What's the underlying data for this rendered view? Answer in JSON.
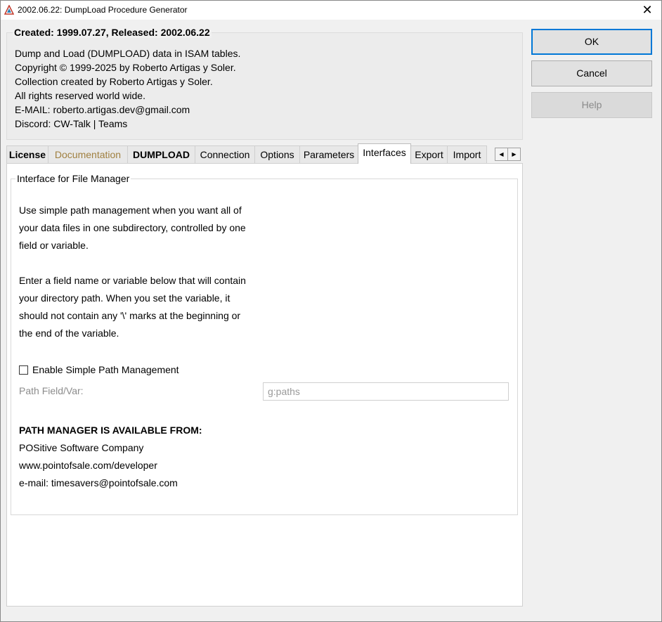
{
  "window": {
    "title": "2002.06.22: DumpLoad Procedure Generator",
    "close_glyph": "✕"
  },
  "info": {
    "caption": "Created: 1999.07.27, Released: 2002.06.22",
    "lines": [
      "Dump and Load (DUMPLOAD) data in ISAM tables.",
      "Copyright © 1999-2025 by Roberto Artigas y Soler.",
      "Collection created by Roberto Artigas y Soler.",
      "All rights reserved world wide.",
      "E-MAIL: roberto.artigas.dev@gmail.com",
      "Discord: CW-Talk | Teams"
    ]
  },
  "buttons": {
    "ok": "OK",
    "cancel": "Cancel",
    "help": "Help"
  },
  "tabs": [
    "License",
    "Documentation",
    "DUMPLOAD",
    "Connection",
    "Options",
    "Parameters",
    "Interfaces",
    "Export",
    "Import"
  ],
  "tab_scroll": {
    "left": "◀",
    "right": "▶"
  },
  "interfaces": {
    "group_caption": "Interface for File Manager",
    "para1": [
      "Use simple path management when you want all of",
      "your data files in one subdirectory, controlled by one",
      "field or variable."
    ],
    "para2": [
      "Enter a field name or variable below that will contain",
      "your directory path. When you set the variable, it",
      "should not contain any '\\' marks at the beginning or",
      "the end of the variable."
    ],
    "checkbox_label": "Enable Simple Path Management",
    "path_label": "Path Field/Var:",
    "path_value": "g:paths",
    "available_header": "PATH MANAGER IS AVAILABLE FROM:",
    "available_lines": [
      "POSitive Software Company",
      "www.pointofsale.com/developer",
      "e-mail: timesavers@pointofsale.com"
    ]
  },
  "colors": {
    "accent": "#0078d7",
    "muted_tab": "#a08040"
  }
}
